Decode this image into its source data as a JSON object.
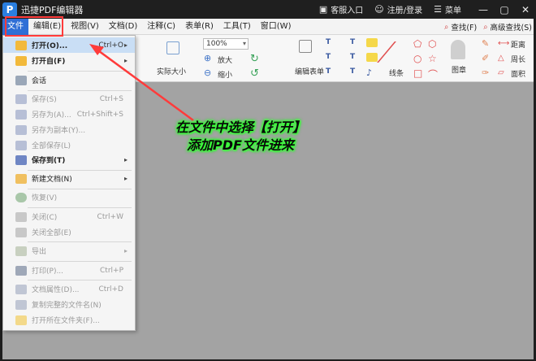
{
  "window": {
    "logo": "P",
    "title": "迅捷PDF编辑器",
    "actions": [
      {
        "label": "客服入口",
        "icon": "chat-icon"
      },
      {
        "label": "注册/登录",
        "icon": "user-icon"
      },
      {
        "label": "菜单",
        "icon": "menu-icon"
      }
    ],
    "controls": {
      "minimize": "—",
      "maximize": "▢",
      "close": "✕"
    }
  },
  "menubar": {
    "items": [
      "文件",
      "编辑(E)",
      "视图(V)",
      "文档(D)",
      "注释(C)",
      "表单(R)",
      "工具(T)",
      "窗口(W)"
    ],
    "right": [
      {
        "label": "查找(F)",
        "icon": "search-icon"
      },
      {
        "label": "高级查找(S)",
        "icon": "advanced-search-icon"
      }
    ]
  },
  "ribbon": {
    "zoom": "100%",
    "labels": {
      "actual_size": "实际大小",
      "zoom_in": "放大",
      "zoom_out": "缩小",
      "edit_form": "编辑表单",
      "line": "线条",
      "stamp": "图章",
      "distance": "距离",
      "perimeter": "周长",
      "area": "面积"
    }
  },
  "file_menu": {
    "items": [
      {
        "label": "打开(O)...",
        "shortcut": "Ctrl+O",
        "submenu": true,
        "highlighted": true,
        "icon": "folder-open-icon"
      },
      {
        "label": "打开自(F)",
        "shortcut": "",
        "submenu": true,
        "icon": "folder-from-icon"
      },
      {
        "label": "会话",
        "shortcut": "",
        "submenu": false,
        "icon": "session-icon"
      },
      {
        "label": "保存(S)",
        "shortcut": "Ctrl+S",
        "disabled": true,
        "icon": "save-icon"
      },
      {
        "label": "另存为(A)...",
        "shortcut": "Ctrl+Shift+S",
        "disabled": true,
        "icon": "save-as-icon"
      },
      {
        "label": "另存为副本(Y)...",
        "shortcut": "",
        "disabled": true,
        "icon": "save-copy-icon"
      },
      {
        "label": "全部保存(L)",
        "shortcut": "",
        "disabled": true,
        "icon": "save-all-icon"
      },
      {
        "label": "保存到(T)",
        "shortcut": "",
        "submenu": true,
        "icon": "save-to-icon"
      },
      {
        "label": "新建文档(N)",
        "shortcut": "",
        "submenu": true,
        "icon": "new-doc-icon"
      },
      {
        "label": "恢复(V)",
        "shortcut": "",
        "disabled": true,
        "icon": "restore-icon"
      },
      {
        "label": "关闭(C)",
        "shortcut": "Ctrl+W",
        "disabled": true,
        "icon": "close-doc-icon"
      },
      {
        "label": "关闭全部(E)",
        "shortcut": "",
        "disabled": true,
        "icon": "close-all-icon"
      },
      {
        "label": "导出",
        "shortcut": "",
        "submenu": true,
        "disabled": true,
        "icon": "export-icon"
      },
      {
        "label": "打印(P)...",
        "shortcut": "Ctrl+P",
        "disabled": true,
        "icon": "print-icon"
      },
      {
        "label": "文档属性(D)...",
        "shortcut": "Ctrl+D",
        "disabled": true,
        "icon": "properties-icon"
      },
      {
        "label": "复制完整的文件名(N)",
        "shortcut": "",
        "disabled": true,
        "icon": "copy-filename-icon"
      },
      {
        "label": "打开所在文件夹(F)...",
        "shortcut": "",
        "disabled": true,
        "icon": "open-folder-icon"
      }
    ]
  },
  "annotation": {
    "line1": "在文件中选择【打开】",
    "line2": "添加PDF文件进来",
    "color": "#35ff35",
    "arrow_color": "#ff3b3b"
  }
}
